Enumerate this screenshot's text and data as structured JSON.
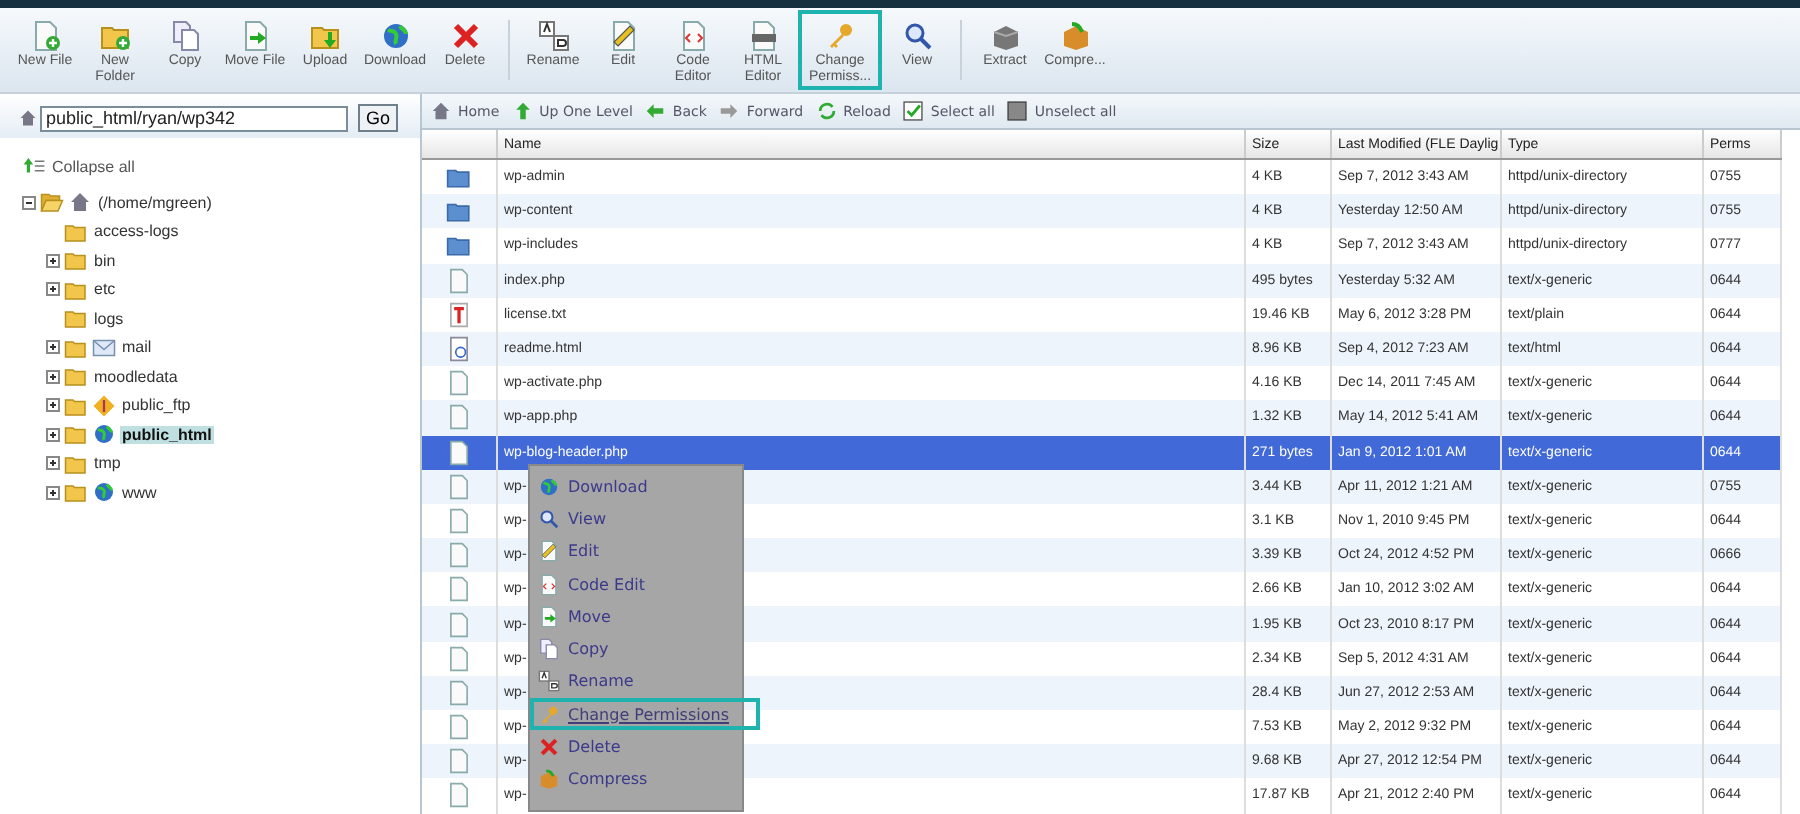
{
  "toolbar": [
    {
      "label": "New File",
      "highlighted": false
    },
    {
      "label": "New Folder",
      "highlighted": false
    },
    {
      "label": "Copy",
      "highlighted": false
    },
    {
      "label": "Move File",
      "highlighted": false
    },
    {
      "label": "Upload",
      "highlighted": false
    },
    {
      "label": "Download",
      "highlighted": false
    },
    {
      "label": "Delete",
      "highlighted": false
    },
    {
      "label": "Rename",
      "highlighted": false
    },
    {
      "label": "Edit",
      "highlighted": false
    },
    {
      "label": "Code Editor",
      "highlighted": false
    },
    {
      "label": "HTML Editor",
      "highlighted": false
    },
    {
      "label": "Change Permiss...",
      "highlighted": true
    },
    {
      "label": "View",
      "highlighted": false
    },
    {
      "label": "Extract",
      "highlighted": false
    },
    {
      "label": "Compre...",
      "highlighted": false
    }
  ],
  "path": {
    "value": "public_html/ryan/wp342",
    "button": "Go"
  },
  "collapse_all": "Collapse all",
  "tree": [
    {
      "label": "(/home/mgreen)",
      "kind": "home",
      "expanded": true,
      "selected": false,
      "children": [
        {
          "label": "access-logs",
          "kind": "plain",
          "selected": false
        },
        {
          "label": "bin",
          "kind": "plain",
          "expanded": false,
          "selected": false
        },
        {
          "label": "etc",
          "kind": "plain",
          "expanded": false,
          "selected": false
        },
        {
          "label": "logs",
          "kind": "plain",
          "selected": false
        },
        {
          "label": "mail",
          "kind": "mail",
          "expanded": false,
          "selected": false
        },
        {
          "label": "moodledata",
          "kind": "plain",
          "expanded": false,
          "selected": false
        },
        {
          "label": "public_ftp",
          "kind": "ftp",
          "expanded": false,
          "selected": false
        },
        {
          "label": "public_html",
          "kind": "web",
          "expanded": false,
          "selected": true
        },
        {
          "label": "tmp",
          "kind": "plain",
          "expanded": false,
          "selected": false
        },
        {
          "label": "www",
          "kind": "web",
          "expanded": false,
          "selected": false
        }
      ]
    }
  ],
  "actions": [
    "Home",
    "Up One Level",
    "Back",
    "Forward",
    "Reload",
    "Select all",
    "Unselect all"
  ],
  "table": {
    "columns": [
      "Name",
      "Size",
      "Last Modified (FLE Daylig",
      "Type",
      "Perms"
    ],
    "rows": [
      {
        "kind": "folder",
        "name": "wp-admin",
        "size": "4 KB",
        "modified": "Sep 7, 2012 3:43 AM",
        "type": "httpd/unix-directory",
        "perms": "0755",
        "selected": false
      },
      {
        "kind": "folder",
        "name": "wp-content",
        "size": "4 KB",
        "modified": "Yesterday 12:50 AM",
        "type": "httpd/unix-directory",
        "perms": "0755",
        "selected": false
      },
      {
        "kind": "folder",
        "name": "wp-includes",
        "size": "4 KB",
        "modified": "Sep 7, 2012 3:43 AM",
        "type": "httpd/unix-directory",
        "perms": "0777",
        "selected": false
      },
      {
        "kind": "file",
        "name": "index.php",
        "size": "495 bytes",
        "modified": "Yesterday 5:32 AM",
        "type": "text/x-generic",
        "perms": "0644",
        "selected": false
      },
      {
        "kind": "text",
        "name": "license.txt",
        "size": "19.46 KB",
        "modified": "May 6, 2012 3:28 PM",
        "type": "text/plain",
        "perms": "0644",
        "selected": false
      },
      {
        "kind": "html",
        "name": "readme.html",
        "size": "8.96 KB",
        "modified": "Sep 4, 2012 7:23 AM",
        "type": "text/html",
        "perms": "0644",
        "selected": false
      },
      {
        "kind": "file",
        "name": "wp-activate.php",
        "size": "4.16 KB",
        "modified": "Dec 14, 2011 7:45 AM",
        "type": "text/x-generic",
        "perms": "0644",
        "selected": false
      },
      {
        "kind": "file",
        "name": "wp-app.php",
        "size": "1.32 KB",
        "modified": "May 14, 2012 5:41 AM",
        "type": "text/x-generic",
        "perms": "0644",
        "selected": false
      },
      {
        "kind": "file",
        "name": "wp-blog-header.php",
        "size": "271 bytes",
        "modified": "Jan 9, 2012 1:01 AM",
        "type": "text/x-generic",
        "perms": "0644",
        "selected": true
      },
      {
        "kind": "file",
        "name": "wp-",
        "size": "3.44 KB",
        "modified": "Apr 11, 2012 1:21 AM",
        "type": "text/x-generic",
        "perms": "0755",
        "selected": false
      },
      {
        "kind": "file",
        "name": "wp-",
        "size": "3.1 KB",
        "modified": "Nov 1, 2010 9:45 PM",
        "type": "text/x-generic",
        "perms": "0644",
        "selected": false
      },
      {
        "kind": "file",
        "name": "wp-",
        "size": "3.39 KB",
        "modified": "Oct 24, 2012 4:52 PM",
        "type": "text/x-generic",
        "perms": "0666",
        "selected": false
      },
      {
        "kind": "file",
        "name": "wp-",
        "size": "2.66 KB",
        "modified": "Jan 10, 2012 3:02 AM",
        "type": "text/x-generic",
        "perms": "0644",
        "selected": false
      },
      {
        "kind": "file",
        "name": "wp-",
        "size": "1.95 KB",
        "modified": "Oct 23, 2010 8:17 PM",
        "type": "text/x-generic",
        "perms": "0644",
        "selected": false
      },
      {
        "kind": "file",
        "name": "wp-",
        "size": "2.34 KB",
        "modified": "Sep 5, 2012 4:31 AM",
        "type": "text/x-generic",
        "perms": "0644",
        "selected": false
      },
      {
        "kind": "file",
        "name": "wp-",
        "size": "28.4 KB",
        "modified": "Jun 27, 2012 2:53 AM",
        "type": "text/x-generic",
        "perms": "0644",
        "selected": false
      },
      {
        "kind": "file",
        "name": "wp-",
        "size": "7.53 KB",
        "modified": "May 2, 2012 9:32 PM",
        "type": "text/x-generic",
        "perms": "0644",
        "selected": false
      },
      {
        "kind": "file",
        "name": "wp-",
        "size": "9.68 KB",
        "modified": "Apr 27, 2012 12:54 PM",
        "type": "text/x-generic",
        "perms": "0644",
        "selected": false
      },
      {
        "kind": "file",
        "name": "wp-",
        "size": "17.87 KB",
        "modified": "Apr 21, 2012 2:40 PM",
        "type": "text/x-generic",
        "perms": "0644",
        "selected": false
      }
    ]
  },
  "context_menu": [
    {
      "label": "Download",
      "highlighted": false
    },
    {
      "label": "View",
      "highlighted": false
    },
    {
      "label": "Edit",
      "highlighted": false
    },
    {
      "label": "Code Edit",
      "highlighted": false
    },
    {
      "label": "Move",
      "highlighted": false
    },
    {
      "label": "Copy",
      "highlighted": false
    },
    {
      "label": "Rename",
      "highlighted": false
    },
    {
      "label": "Change Permissions",
      "highlighted": true
    },
    {
      "label": "Delete",
      "highlighted": false
    },
    {
      "label": "Compress",
      "highlighted": false
    }
  ]
}
